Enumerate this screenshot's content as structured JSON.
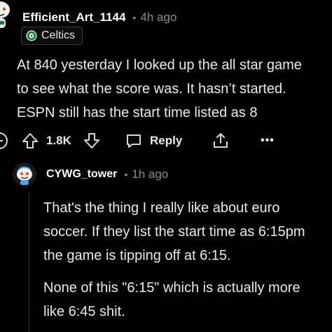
{
  "comment": {
    "username": "Efficient_Art_1144",
    "time": "4h ago",
    "flair": "Celtics",
    "body_lines": [
      "At 840 yesterday I looked up the all star game",
      "to see what the score was. It hasn’t started.",
      "ESPN still has the start time listed as 8"
    ],
    "score": "1.8K",
    "reply_label": "Reply",
    "more_label": "•••"
  },
  "reply": {
    "username": "CYWG_tower",
    "time": "1h ago",
    "paragraph1_lines": [
      "That's the thing I really like about euro",
      "soccer. If they list the start time as 6:15pm",
      "the game is tipping off at 6:15."
    ],
    "paragraph2_lines": [
      "None of this \"6:15\" which is actually more",
      "like 6:45 shit."
    ]
  },
  "separator_dot": "•",
  "colors": {
    "background": "#000000",
    "text": "#e9eaec",
    "meta": "#8a8c8f",
    "celtics_green": "#007a33",
    "avatar_blue": "#4aa6e8"
  },
  "icons": [
    "snoo-avatar-icon",
    "celtics-logo-icon",
    "collapse-icon",
    "upvote-icon",
    "downvote-icon",
    "reply-bubble-icon",
    "share-icon",
    "more-options-icon"
  ]
}
